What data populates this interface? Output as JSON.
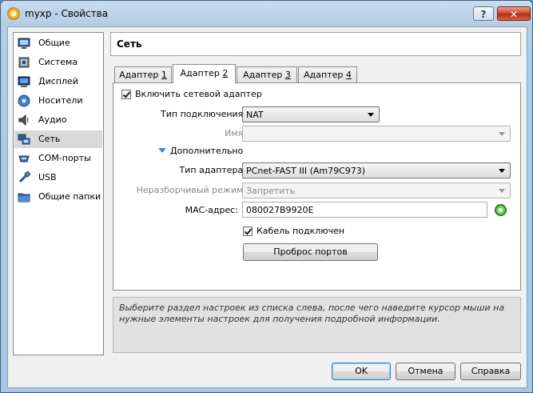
{
  "window": {
    "title": "myxp - Свойства",
    "help_label": "?",
    "close_label": "✕"
  },
  "sidebar": {
    "items": [
      {
        "label": "Общие",
        "icon": "general-icon"
      },
      {
        "label": "Система",
        "icon": "system-icon"
      },
      {
        "label": "Дисплей",
        "icon": "display-icon"
      },
      {
        "label": "Носители",
        "icon": "storage-icon"
      },
      {
        "label": "Аудио",
        "icon": "audio-icon"
      },
      {
        "label": "Сеть",
        "icon": "network-icon",
        "selected": true
      },
      {
        "label": "COM-порты",
        "icon": "serial-ports-icon"
      },
      {
        "label": "USB",
        "icon": "usb-icon"
      },
      {
        "label": "Общие папки",
        "icon": "shared-folders-icon"
      }
    ]
  },
  "page": {
    "title": "Сеть"
  },
  "tabs": [
    {
      "label": "Адаптер ",
      "key": "1"
    },
    {
      "label": "Адаптер ",
      "key": "2",
      "active": true
    },
    {
      "label": "Адаптер ",
      "key": "3"
    },
    {
      "label": "Адаптер ",
      "key": "4"
    }
  ],
  "adapter": {
    "enable_label": "Включить сетевой адаптер",
    "enabled": true,
    "attached_label": "Тип подключения:",
    "attached_value": "NAT",
    "name_label": "Имя:",
    "name_value": "",
    "advanced_label": "Дополнительно",
    "type_label": "Тип адаптера:",
    "type_value": "PCnet-FAST III (Am79C973)",
    "promisc_label": "Неразборчивый режим:",
    "promisc_value": "Запретить",
    "mac_label": "MAC-адрес:",
    "mac_value": "080027B9920E",
    "cable_label": "Кабель подключен",
    "cable_connected": true,
    "port_forward_label": "Проброс портов"
  },
  "info": {
    "text": "Выберите раздел настроек из списка слева, после чего наведите курсор мыши на нужные элементы настроек для получения подробной информации."
  },
  "buttons": {
    "ok": "OK",
    "cancel": "Отмена",
    "help": "Справка"
  },
  "colors": {
    "accent": "#3d8ad6",
    "selection": "#d9d9d9"
  }
}
